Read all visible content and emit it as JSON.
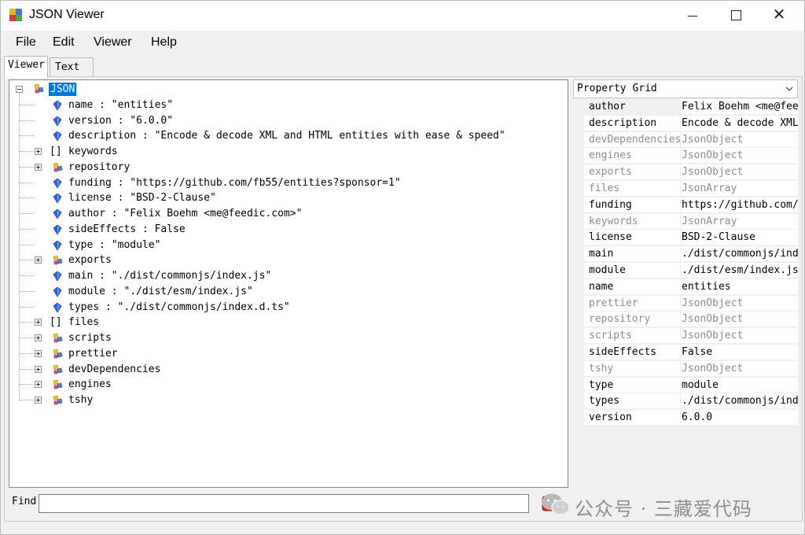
{
  "window": {
    "title": "JSON Viewer",
    "minimize_icon": "minimize-icon",
    "maximize_icon": "maximize-icon",
    "close_icon": "close-icon"
  },
  "menu": [
    "File",
    "Edit",
    "Viewer",
    "Help"
  ],
  "tabs": {
    "viewer": "Viewer",
    "text": "Text"
  },
  "tree": {
    "root": "JSON",
    "nodes": [
      {
        "text": "name : \"entities\"",
        "kind": "value",
        "expander": false
      },
      {
        "text": "version : \"6.0.0\"",
        "kind": "value",
        "expander": false
      },
      {
        "text": "description : \"Encode & decode XML and HTML entities with ease & speed\"",
        "kind": "value",
        "expander": false
      },
      {
        "text": "keywords",
        "kind": "array",
        "expander": true
      },
      {
        "text": "repository",
        "kind": "object",
        "expander": true
      },
      {
        "text": "funding : \"https://github.com/fb55/entities?sponsor=1\"",
        "kind": "value",
        "expander": false
      },
      {
        "text": "license : \"BSD-2-Clause\"",
        "kind": "value",
        "expander": false
      },
      {
        "text": "author : \"Felix Boehm <me@feedic.com>\"",
        "kind": "value",
        "expander": false
      },
      {
        "text": "sideEffects : False",
        "kind": "value",
        "expander": false
      },
      {
        "text": "type : \"module\"",
        "kind": "value",
        "expander": false
      },
      {
        "text": "exports",
        "kind": "object",
        "expander": true
      },
      {
        "text": "main : \"./dist/commonjs/index.js\"",
        "kind": "value",
        "expander": false
      },
      {
        "text": "module : \"./dist/esm/index.js\"",
        "kind": "value",
        "expander": false
      },
      {
        "text": "types : \"./dist/commonjs/index.d.ts\"",
        "kind": "value",
        "expander": false
      },
      {
        "text": "files",
        "kind": "array",
        "expander": true
      },
      {
        "text": "scripts",
        "kind": "object",
        "expander": true
      },
      {
        "text": "prettier",
        "kind": "object",
        "expander": true
      },
      {
        "text": "devDependencies",
        "kind": "object",
        "expander": true
      },
      {
        "text": "engines",
        "kind": "object",
        "expander": true
      },
      {
        "text": "tshy",
        "kind": "object",
        "expander": true
      }
    ]
  },
  "property_grid": {
    "title": "Property Grid",
    "rows": [
      {
        "name": "author",
        "value": "Felix Boehm <me@feed",
        "readonly": false,
        "selected": true
      },
      {
        "name": "description",
        "value": "Encode & decode XML",
        "readonly": false
      },
      {
        "name": "devDependencies",
        "value": "JsonObject",
        "readonly": true
      },
      {
        "name": "engines",
        "value": "JsonObject",
        "readonly": true
      },
      {
        "name": "exports",
        "value": "JsonObject",
        "readonly": true
      },
      {
        "name": "files",
        "value": "JsonArray",
        "readonly": true
      },
      {
        "name": "funding",
        "value": "https://github.com/f",
        "readonly": false
      },
      {
        "name": "keywords",
        "value": "JsonArray",
        "readonly": true
      },
      {
        "name": "license",
        "value": "BSD-2-Clause",
        "readonly": false
      },
      {
        "name": "main",
        "value": "./dist/commonjs/inde",
        "readonly": false
      },
      {
        "name": "module",
        "value": "./dist/esm/index.js",
        "readonly": false
      },
      {
        "name": "name",
        "value": "entities",
        "readonly": false
      },
      {
        "name": "prettier",
        "value": "JsonObject",
        "readonly": true
      },
      {
        "name": "repository",
        "value": "JsonObject",
        "readonly": true
      },
      {
        "name": "scripts",
        "value": "JsonObject",
        "readonly": true
      },
      {
        "name": "sideEffects",
        "value": "False",
        "readonly": false
      },
      {
        "name": "tshy",
        "value": "JsonObject",
        "readonly": true
      },
      {
        "name": "type",
        "value": "module",
        "readonly": false
      },
      {
        "name": "types",
        "value": "./dist/commonjs/inde",
        "readonly": false
      },
      {
        "name": "version",
        "value": "6.0.0",
        "readonly": false
      }
    ]
  },
  "find": {
    "label": "Find",
    "value": ""
  },
  "watermark": {
    "text": "公众号 · 三藏爱代码"
  },
  "colors": {
    "selection": "#0078d7",
    "readonly_text": "#8c8c8c",
    "clear_button": "#d9262c"
  }
}
